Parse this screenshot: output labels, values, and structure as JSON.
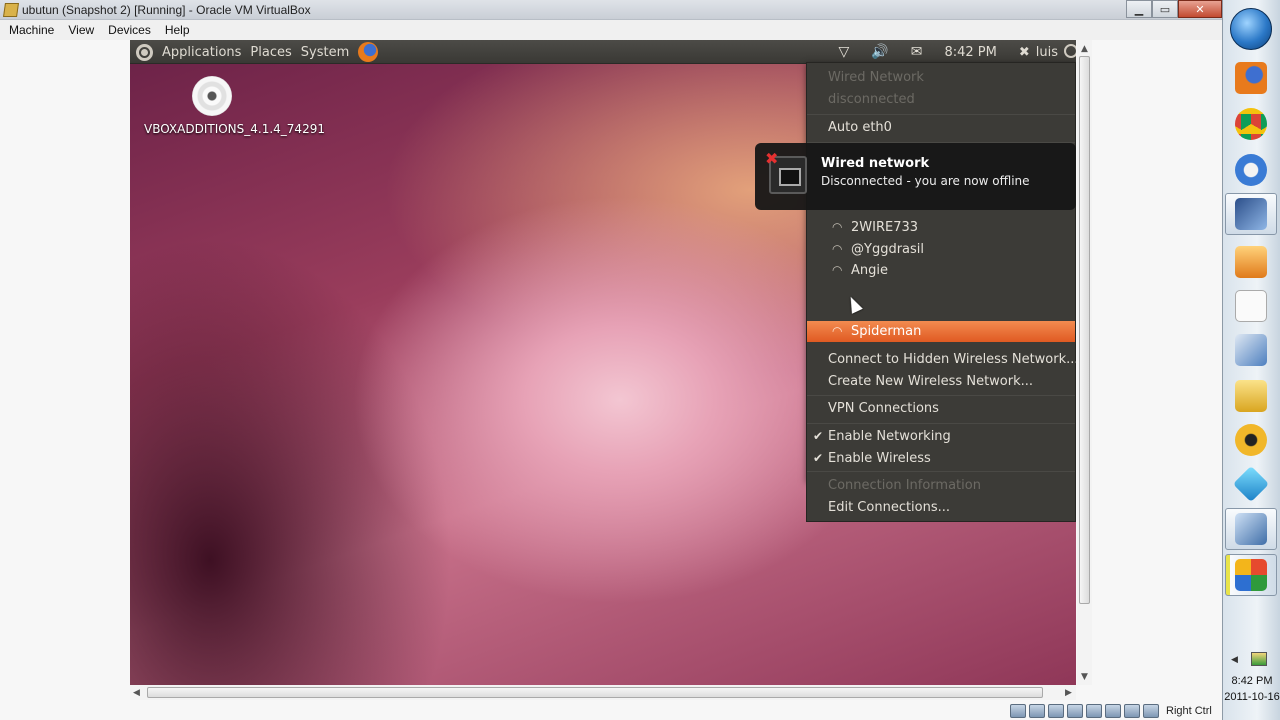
{
  "vbox": {
    "title": "ubutun (Snapshot 2) [Running] - Oracle VM VirtualBox",
    "menu": [
      "Machine",
      "View",
      "Devices",
      "Help"
    ],
    "host_key": "Right Ctrl"
  },
  "panel": {
    "menus": [
      "Applications",
      "Places",
      "System"
    ],
    "clock": "8:42 PM",
    "user": "luis"
  },
  "desktop": {
    "icon_label": "VBOXADDITIONS_4.1.4_74291"
  },
  "network_menu": {
    "wired_header": "Wired Network",
    "wired_status": "disconnected",
    "auto_eth0": "Auto eth0",
    "wireless_networks": [
      "2WIRE733",
      "@Yggdrasil",
      "Angie",
      "Spiderman"
    ],
    "highlighted_network": "Spiderman",
    "connect_hidden": "Connect to Hidden Wireless Network...",
    "create_new": "Create New Wireless Network...",
    "vpn": "VPN Connections",
    "enable_networking": "Enable Networking",
    "enable_wireless": "Enable Wireless",
    "connection_info": "Connection Information",
    "edit_connections": "Edit Connections..."
  },
  "notification": {
    "title": "Wired network",
    "body": "Disconnected - you are now offline"
  },
  "taskbar": {
    "time": "8:42 PM",
    "date": "2011-10-16"
  }
}
